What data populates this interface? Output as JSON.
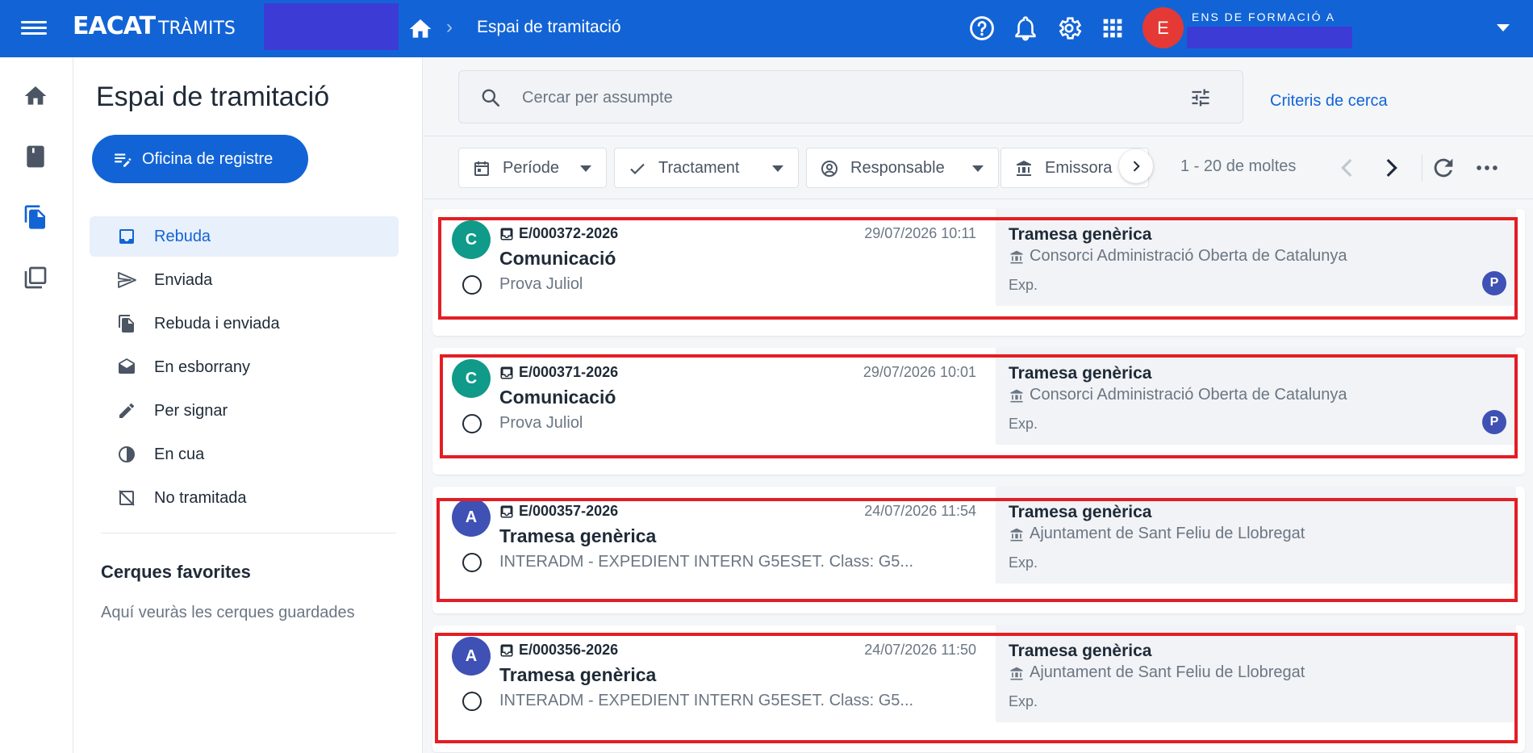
{
  "topbar": {
    "logo_main": "EACAT",
    "logo_sub": "TRÀMITS",
    "breadcrumb_title": "Espai de tramitació",
    "user_avatar_letter": "E",
    "user_name": "ENS DE FORMACIÓ A",
    "bar_color": "#1264d6",
    "redaction_color": "#3c3bd6"
  },
  "sidebar": {
    "title": "Espai de tramitació",
    "office_button": "Oficina de registre",
    "items": [
      {
        "label": "Rebuda",
        "icon": "inbox-icon",
        "active": true
      },
      {
        "label": "Enviada",
        "icon": "send-icon"
      },
      {
        "label": "Rebuda i enviada",
        "icon": "documents-icon"
      },
      {
        "label": "En esborrany",
        "icon": "draft-envelope-icon"
      },
      {
        "label": "Per signar",
        "icon": "sign-pen-icon"
      },
      {
        "label": "En cua",
        "icon": "queue-clock-icon"
      },
      {
        "label": "No tramitada",
        "icon": "not-processed-icon"
      }
    ],
    "favorites_title": "Cerques favorites",
    "favorites_empty": "Aquí veuràs les cerques guardades"
  },
  "search": {
    "placeholder": "Cercar per assumpte",
    "criteria_link": "Criteris de cerca"
  },
  "filters": [
    {
      "label": "Període",
      "icon": "calendar-icon"
    },
    {
      "label": "Tractament",
      "icon": "check-icon"
    },
    {
      "label": "Responsable",
      "icon": "person-circle-icon"
    },
    {
      "label": "Emissora",
      "icon": "institution-icon"
    }
  ],
  "pager": {
    "text": "1 - 20 de moltes"
  },
  "records": [
    {
      "avatar": "C",
      "avatar_color": "#0f9a8a",
      "ref": "E/000372-2026",
      "date": "29/07/2026 10:11",
      "title": "Comunicació",
      "subtitle": "Prova Juliol",
      "type": "Tramesa genèrica",
      "entity": "Consorci Administració Oberta de Catalunya",
      "exp": "Exp.",
      "assignee": "P"
    },
    {
      "avatar": "C",
      "avatar_color": "#0f9a8a",
      "ref": "E/000371-2026",
      "date": "29/07/2026 10:01",
      "title": "Comunicació",
      "subtitle": "Prova Juliol",
      "type": "Tramesa genèrica",
      "entity": "Consorci Administració Oberta de Catalunya",
      "exp": "Exp.",
      "assignee": "P"
    },
    {
      "avatar": "A",
      "avatar_color": "#3f51b5",
      "ref": "E/000357-2026",
      "date": "24/07/2026 11:54",
      "title": "Tramesa genèrica",
      "subtitle": "INTERADM - EXPEDIENT INTERN G5ESET. Class: G5...",
      "type": "Tramesa genèrica",
      "entity": "Ajuntament de Sant Feliu de Llobregat",
      "exp": "Exp.",
      "assignee": ""
    },
    {
      "avatar": "A",
      "avatar_color": "#3f51b5",
      "ref": "E/000356-2026",
      "date": "24/07/2026 11:50",
      "title": "Tramesa genèrica",
      "subtitle": "INTERADM - EXPEDIENT INTERN G5ESET. Class: G5...",
      "type": "Tramesa genèrica",
      "entity": "Ajuntament de Sant Feliu de Llobregat",
      "exp": "Exp.",
      "assignee": ""
    }
  ]
}
